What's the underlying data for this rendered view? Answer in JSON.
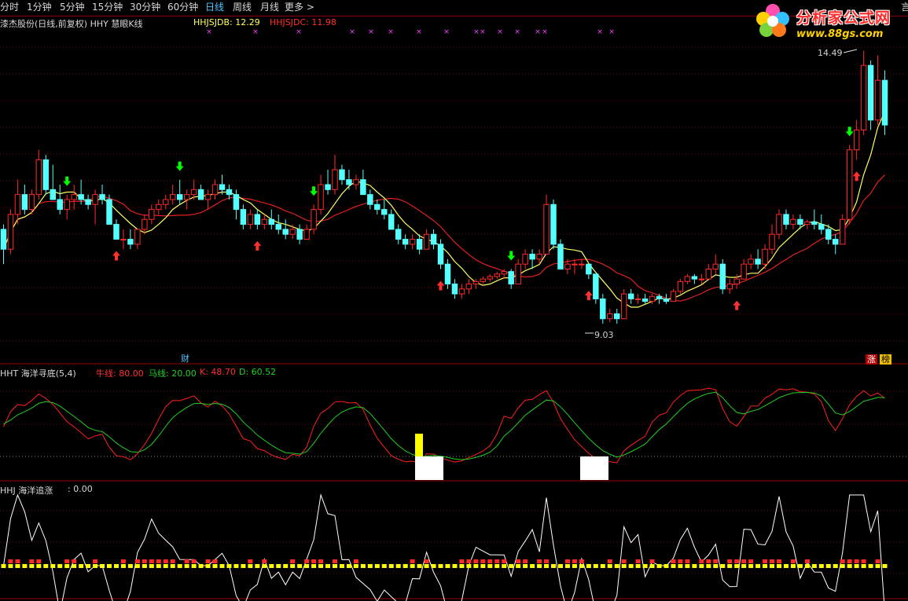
{
  "topbar": {
    "periods": [
      "分时",
      "1分钟",
      "5分钟",
      "15分钟",
      "30分钟",
      "60分钟",
      "日线",
      "周线",
      "月线",
      "更多 >"
    ],
    "active": "日线",
    "right_char": "言"
  },
  "main_panel": {
    "title": "漆杰股份(日线,前复权) HHY 慧眼K线",
    "ind1_label": "HHJSJDB: 12.29",
    "ind2_label": "HHJSJDC: 11.98",
    "high_label": "14.49",
    "low_label": "9.03",
    "finance_badge": "财",
    "zhang_badge": "涨",
    "bang_badge": "榜"
  },
  "logo": {
    "title": "分析家公式网",
    "url": "www.88gs.com"
  },
  "kdj_panel": {
    "title": "HHT 海洋寻底(5,4)",
    "bull_label": "牛线: 80.00",
    "horse_label": "马线: 20.00",
    "k_label": "K: 48.70",
    "d_label": "D: 60.52"
  },
  "chase_panel": {
    "title": "HHJ 海洋追涨",
    "value_label": ": 0.00"
  },
  "colors": {
    "up": "#ff2a2a",
    "down": "#54ffff",
    "ma_short": "#ffff66",
    "ma_long": "#e02020",
    "grid": "#7a0000",
    "k_line": "#ff2020",
    "d_line": "#20d020",
    "white": "#ffffff",
    "yellow": "#ffff00",
    "buy_arrow": "#ff3030",
    "sell_arrow": "#00ff00",
    "cross": "#ff40ff"
  },
  "chart_data": {
    "type": "candlestick",
    "price_range": [
      9.03,
      14.49
    ],
    "price_ylim": [
      8.4,
      15.2
    ],
    "candles": [
      [
        10.9,
        11.0,
        10.2,
        10.5
      ],
      [
        10.5,
        11.3,
        10.4,
        11.2
      ],
      [
        11.2,
        11.9,
        11.0,
        11.6
      ],
      [
        11.6,
        11.8,
        11.2,
        11.3
      ],
      [
        11.3,
        11.7,
        11.2,
        11.6
      ],
      [
        11.6,
        12.5,
        11.5,
        12.3
      ],
      [
        12.3,
        12.4,
        11.6,
        11.7
      ],
      [
        11.7,
        12.2,
        11.5,
        11.5
      ],
      [
        11.5,
        11.8,
        11.2,
        11.3
      ],
      [
        11.3,
        11.6,
        11.1,
        11.5
      ],
      [
        11.5,
        11.8,
        11.3,
        11.6
      ],
      [
        11.6,
        11.9,
        11.4,
        11.5
      ],
      [
        11.5,
        11.6,
        11.3,
        11.4
      ],
      [
        11.4,
        11.7,
        11.0,
        11.6
      ],
      [
        11.6,
        11.8,
        11.4,
        11.5
      ],
      [
        11.5,
        11.6,
        11.0,
        11.0
      ],
      [
        11.0,
        11.1,
        10.7,
        10.7
      ],
      [
        10.7,
        10.9,
        10.5,
        10.7
      ],
      [
        10.7,
        10.9,
        10.5,
        10.6
      ],
      [
        10.6,
        10.9,
        10.5,
        10.9
      ],
      [
        10.9,
        11.2,
        10.8,
        11.1
      ],
      [
        11.1,
        11.4,
        11.0,
        11.3
      ],
      [
        11.3,
        11.5,
        11.2,
        11.4
      ],
      [
        11.4,
        11.6,
        11.3,
        11.5
      ],
      [
        11.5,
        11.8,
        11.4,
        11.6
      ],
      [
        11.6,
        11.9,
        11.4,
        11.5
      ],
      [
        11.5,
        11.7,
        11.3,
        11.6
      ],
      [
        11.6,
        11.9,
        11.5,
        11.7
      ],
      [
        11.7,
        11.8,
        11.5,
        11.5
      ],
      [
        11.5,
        11.7,
        11.3,
        11.6
      ],
      [
        11.6,
        11.9,
        11.5,
        11.8
      ],
      [
        11.8,
        12.0,
        11.6,
        11.7
      ],
      [
        11.7,
        11.8,
        11.5,
        11.6
      ],
      [
        11.6,
        11.7,
        11.1,
        11.3
      ],
      [
        11.3,
        11.4,
        10.9,
        11.0
      ],
      [
        11.0,
        11.3,
        10.9,
        11.2
      ],
      [
        11.2,
        11.3,
        10.9,
        11.0
      ],
      [
        11.0,
        11.2,
        10.9,
        11.1
      ],
      [
        11.1,
        11.3,
        10.9,
        11.0
      ],
      [
        11.0,
        11.2,
        10.8,
        10.9
      ],
      [
        10.9,
        11.1,
        10.7,
        10.8
      ],
      [
        10.8,
        11.0,
        10.7,
        10.9
      ],
      [
        10.9,
        11.0,
        10.6,
        10.7
      ],
      [
        10.7,
        11.0,
        10.7,
        10.9
      ],
      [
        10.9,
        11.4,
        10.8,
        11.3
      ],
      [
        11.3,
        12.0,
        11.2,
        11.8
      ],
      [
        11.8,
        12.1,
        11.6,
        11.7
      ],
      [
        11.7,
        12.4,
        11.6,
        12.1
      ],
      [
        12.1,
        12.2,
        11.8,
        11.9
      ],
      [
        11.9,
        12.1,
        11.7,
        11.8
      ],
      [
        11.8,
        12.0,
        11.7,
        11.9
      ],
      [
        11.9,
        12.1,
        11.6,
        11.6
      ],
      [
        11.6,
        11.7,
        11.3,
        11.4
      ],
      [
        11.4,
        11.5,
        11.2,
        11.3
      ],
      [
        11.3,
        11.5,
        11.1,
        11.2
      ],
      [
        11.2,
        11.3,
        10.9,
        10.9
      ],
      [
        10.9,
        11.0,
        10.6,
        10.7
      ],
      [
        10.7,
        10.8,
        10.5,
        10.6
      ],
      [
        10.6,
        10.8,
        10.5,
        10.7
      ],
      [
        10.7,
        10.8,
        10.4,
        10.5
      ],
      [
        10.5,
        10.9,
        10.5,
        10.8
      ],
      [
        10.8,
        10.9,
        10.5,
        10.6
      ],
      [
        10.6,
        10.7,
        10.1,
        10.2
      ],
      [
        10.2,
        10.3,
        9.7,
        9.8
      ],
      [
        9.8,
        9.9,
        9.5,
        9.6
      ],
      [
        9.6,
        9.8,
        9.5,
        9.7
      ],
      [
        9.7,
        9.9,
        9.6,
        9.8
      ],
      [
        9.8,
        9.9,
        9.7,
        9.85
      ],
      [
        9.85,
        9.95,
        9.8,
        9.9
      ],
      [
        9.9,
        10.0,
        9.85,
        9.95
      ],
      [
        9.95,
        10.05,
        9.9,
        10.0
      ],
      [
        10.0,
        10.1,
        9.9,
        10.05
      ],
      [
        10.05,
        10.1,
        9.7,
        9.8
      ],
      [
        9.8,
        10.3,
        9.8,
        10.2
      ],
      [
        10.2,
        10.5,
        10.1,
        10.4
      ],
      [
        10.4,
        10.5,
        10.1,
        10.3
      ],
      [
        10.3,
        10.5,
        10.2,
        10.4
      ],
      [
        10.4,
        11.6,
        10.4,
        11.4
      ],
      [
        11.4,
        11.5,
        10.5,
        10.6
      ],
      [
        10.6,
        10.7,
        10.1,
        10.1
      ],
      [
        10.1,
        10.3,
        10.0,
        10.2
      ],
      [
        10.2,
        10.3,
        10.0,
        10.2
      ],
      [
        10.2,
        10.3,
        10.1,
        10.2
      ],
      [
        10.2,
        10.2,
        9.9,
        10.0
      ],
      [
        10.0,
        10.0,
        9.4,
        9.5
      ],
      [
        9.5,
        9.6,
        9.0,
        9.1
      ],
      [
        9.1,
        9.3,
        9.03,
        9.2
      ],
      [
        9.2,
        9.3,
        9.0,
        9.1
      ],
      [
        9.1,
        9.7,
        9.1,
        9.6
      ],
      [
        9.6,
        9.7,
        9.4,
        9.5
      ],
      [
        9.5,
        9.6,
        9.4,
        9.5
      ],
      [
        9.5,
        9.6,
        9.4,
        9.45
      ],
      [
        9.45,
        9.6,
        9.4,
        9.55
      ],
      [
        9.55,
        9.6,
        9.4,
        9.5
      ],
      [
        9.5,
        9.6,
        9.4,
        9.45
      ],
      [
        9.45,
        9.7,
        9.45,
        9.65
      ],
      [
        9.65,
        9.9,
        9.6,
        9.85
      ],
      [
        9.85,
        10.0,
        9.8,
        9.95
      ],
      [
        9.95,
        10.0,
        9.8,
        9.9
      ],
      [
        9.9,
        10.0,
        9.8,
        9.9
      ],
      [
        9.9,
        10.2,
        9.9,
        10.1
      ],
      [
        10.1,
        10.4,
        10.0,
        10.2
      ],
      [
        10.2,
        10.3,
        9.6,
        9.7
      ],
      [
        9.7,
        9.9,
        9.6,
        9.8
      ],
      [
        9.8,
        10.0,
        9.7,
        9.9
      ],
      [
        9.9,
        10.3,
        9.9,
        10.2
      ],
      [
        10.2,
        10.4,
        10.1,
        10.3
      ],
      [
        10.3,
        10.5,
        10.1,
        10.2
      ],
      [
        10.2,
        10.6,
        10.1,
        10.5
      ],
      [
        10.5,
        11.0,
        10.4,
        10.8
      ],
      [
        10.8,
        11.3,
        10.7,
        11.2
      ],
      [
        11.2,
        11.3,
        10.9,
        11.0
      ],
      [
        11.0,
        11.2,
        10.9,
        11.1
      ],
      [
        11.1,
        11.2,
        10.9,
        11.0
      ],
      [
        11.0,
        11.1,
        10.9,
        11.05
      ],
      [
        11.05,
        11.3,
        10.9,
        11.0
      ],
      [
        11.0,
        11.2,
        10.8,
        10.9
      ],
      [
        10.9,
        11.0,
        10.6,
        10.7
      ],
      [
        10.7,
        10.8,
        10.4,
        10.6
      ],
      [
        10.6,
        11.2,
        10.6,
        11.1
      ],
      [
        11.1,
        12.6,
        11.0,
        12.5
      ],
      [
        12.5,
        13.1,
        12.3,
        12.9
      ],
      [
        12.9,
        14.49,
        12.8,
        14.2
      ],
      [
        14.2,
        14.3,
        12.9,
        13.1
      ],
      [
        13.1,
        14.4,
        13.0,
        13.9
      ],
      [
        13.9,
        14.1,
        12.8,
        13.0
      ]
    ],
    "buy_signal_indices": [
      16,
      36,
      62,
      83,
      104,
      121
    ],
    "sell_signal_indices": [
      9,
      25,
      44,
      72,
      120
    ],
    "kdj": {
      "bull_level": 80.0,
      "horse_level": 20.0,
      "k_current": 48.7,
      "d_current": 60.52
    },
    "chase": {
      "current": 0.0
    }
  }
}
